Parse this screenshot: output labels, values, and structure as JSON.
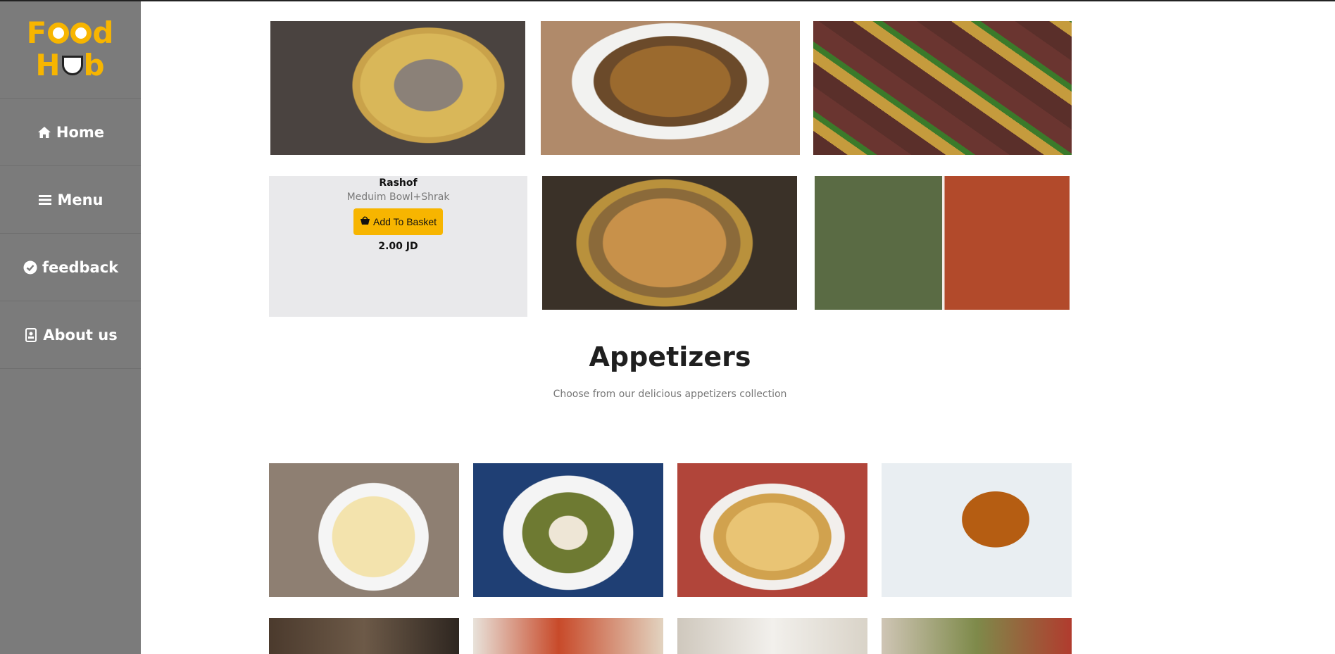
{
  "brand": {
    "line1": "Food",
    "line2": "Hub"
  },
  "nav": [
    {
      "label": "Home",
      "icon": "home-icon"
    },
    {
      "label": "Menu",
      "icon": "bars-icon"
    },
    {
      "label": "feedback",
      "icon": "check-circle-icon"
    },
    {
      "label": "About us",
      "icon": "id-card-icon"
    }
  ],
  "featured_card": {
    "title": "Rashof",
    "subtitle": "Meduim Bowl+Shrak",
    "button_label": "Add To Basket",
    "price": "2.00 JD"
  },
  "appetizers": {
    "title": "Appetizers",
    "subtitle": "Choose from our delicious appetizers collection"
  },
  "colors": {
    "sidebar": "#7b7b7b",
    "accent": "#f7b500",
    "card_bg": "#e9e9eb"
  }
}
